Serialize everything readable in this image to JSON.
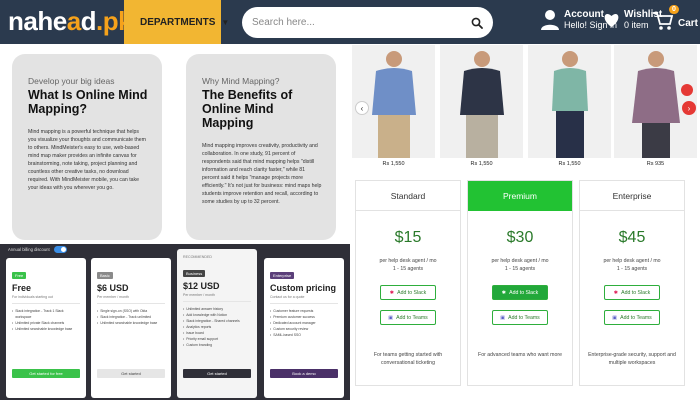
{
  "header": {
    "logo_main": "nahe",
    "logo_a": "a",
    "logo_d": "d",
    "logo_suffix": ".pk",
    "departments_label": "DEPARTMENTS",
    "search_placeholder": "Search here...",
    "account_label": "Account",
    "account_sub": "Hello! Sign in",
    "wishlist_label": "Wishlist",
    "wishlist_sub": "0 item",
    "cart_label": "Cart",
    "cart_count": "0"
  },
  "mindmap": [
    {
      "eyebrow": "Develop your big ideas",
      "title": "What Is Online Mind Mapping?",
      "body": "Mind mapping is a powerful technique that helps you visualize your thoughts and communicate them to others. MindMeister's easy to use, web-based mind map maker provides an infinite canvas for brainstorming, note taking, project planning and countless other creative tasks, no download required. With MindMeister mobile, you can take your ideas with you wherever you go."
    },
    {
      "eyebrow": "Why Mind Mapping?",
      "title": "The Benefits of Online Mind Mapping",
      "body": "Mind mapping improves creativity, productivity and collaboration. In one study, 91 percent of respondents said that mind mapping helps \"distill information and reach clarity faster,\" while 81 percent said it helps \"manage projects more efficiently.\" It's not just for business: mind maps help students improve retention and recall, according to some studies by up to 32 percent."
    }
  ],
  "products": [
    {
      "price": "Rs 1,550",
      "shirt_color": "#6f8fc7",
      "pants_color": "#c9b08a"
    },
    {
      "price": "Rs 1,550",
      "shirt_color": "#2d3446",
      "pants_color": "#b8b0a0"
    },
    {
      "price": "Rs 1,550",
      "shirt_color": "#7fb6a6",
      "pants_color": "#283048"
    },
    {
      "price": "Rs 935",
      "shirt_color": "#8e6d86",
      "pants_color": "#3b3b45"
    }
  ],
  "plans": [
    {
      "name": "Standard",
      "price": "$15",
      "desc1": "per help desk agent / mo",
      "desc2": "1 - 15 agents",
      "btn_slack": "Add to Slack",
      "btn_teams": "Add to Teams",
      "footer": "For teams getting started with conversational ticketing"
    },
    {
      "name": "Premium",
      "price": "$30",
      "desc1": "per help desk agent / mo",
      "desc2": "1 - 15 agents",
      "btn_slack": "Add to Slack",
      "btn_teams": "Add to Teams",
      "footer": "For advanced teams who want more"
    },
    {
      "name": "Enterprise",
      "price": "$45",
      "desc1": "per help desk agent / mo",
      "desc2": "1 - 15 agents",
      "btn_slack": "Add to Slack",
      "btn_teams": "Add to Teams",
      "footer": "Enterprise-grade security, support and multiple workspaces"
    }
  ],
  "dark_pricing": {
    "toggle_label": "Annual billing discount",
    "cards": [
      {
        "badge": "Free",
        "badge_color": "#3ac24a",
        "price": "Free",
        "sub": "For individuals starting out",
        "features": [
          "Slack integration - Track 1 Slack workspace",
          "Unlimited private Slack channels",
          "Unlimited searchable knowledge base"
        ],
        "button": "Get started for free",
        "button_bg": "#3ac24a",
        "button_fg": "#ffffff"
      },
      {
        "badge": "Basic",
        "badge_color": "#8a8a8a",
        "price": "$6 USD",
        "sub": "Per member / month",
        "features": [
          "Single sign-on (SSO) with Okta",
          "Slack integration - Track unlimited",
          "Unlimited searchable knowledge base"
        ],
        "button": "Get started",
        "button_bg": "#e6e6e6",
        "button_fg": "#444444"
      },
      {
        "badge": "Business",
        "badge_color": "#444444",
        "top_label": "RECOMMENDED",
        "price": "$12 USD",
        "sub": "Per member / month",
        "features": [
          "Unlimited answer history",
          "Add knowledge with Notion",
          "Slack integration - Shared channels",
          "Analytics reports",
          "Issue board",
          "Priority email support",
          "Custom branding"
        ],
        "button": "Get started",
        "button_bg": "#2f2f38",
        "button_fg": "#ffffff"
      },
      {
        "badge": "Enterprise",
        "badge_color": "#5b3f7a",
        "price": "Custom pricing",
        "sub": "Contact us for a quote",
        "features": [
          "Customer feature requests",
          "Premium customer success",
          "Dedicated account manager",
          "Custom security review",
          "SAML-based SSO"
        ],
        "button": "Book a demo",
        "button_bg": "#4a3068",
        "button_fg": "#ffffff"
      }
    ]
  }
}
